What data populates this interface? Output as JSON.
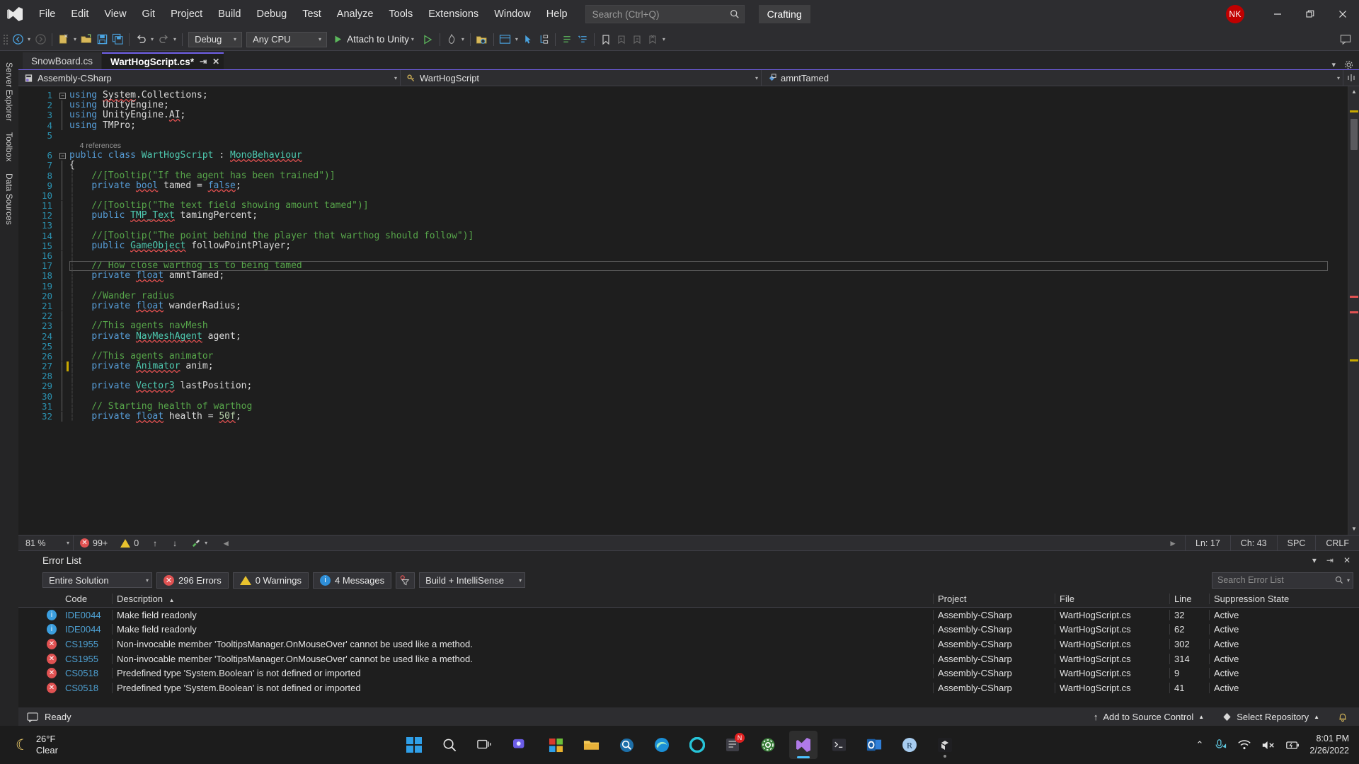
{
  "titlebar": {
    "menu": [
      "File",
      "Edit",
      "View",
      "Git",
      "Project",
      "Build",
      "Debug",
      "Test",
      "Analyze",
      "Tools",
      "Extensions",
      "Window",
      "Help"
    ],
    "search_placeholder": "Search (Ctrl+Q)",
    "solution_name": "Crafting",
    "avatar_initials": "NK",
    "minimize_label": "—",
    "restore_label": "❐",
    "close_label": "✕"
  },
  "toolbar": {
    "config": "Debug",
    "platform": "Any CPU",
    "run_label": "Attach to Unity",
    "undo_icon": "undo-icon",
    "redo_icon": "redo-icon",
    "save_icon": "save-icon",
    "save_all_icon": "save-all-icon",
    "new_project_icon": "new-project-icon",
    "open_file_icon": "open-file-icon",
    "back_icon": "navigate-back-icon",
    "forward_icon": "navigate-forward-icon"
  },
  "left_rail": [
    "Server Explorer",
    "Toolbox",
    "Data Sources"
  ],
  "tabs": [
    {
      "label": "SnowBoard.cs",
      "active": false
    },
    {
      "label": "WartHogScript.cs*",
      "active": true
    }
  ],
  "navbar": {
    "project": "Assembly-CSharp",
    "type": "WartHogScript",
    "member": "amntTamed"
  },
  "editor": {
    "reference_hint": "4 references",
    "reference_hint_line": 6,
    "current_line": 17,
    "changed_lines": [
      27
    ],
    "lines": [
      {
        "n": 1,
        "fold": "minus",
        "tokens": [
          {
            "t": "using ",
            "c": "kw"
          },
          {
            "t": "System",
            "c": "sq-plain"
          },
          {
            "t": ".Collections;",
            "c": "plain"
          }
        ]
      },
      {
        "n": 2,
        "tokens": [
          {
            "t": "using ",
            "c": "kw"
          },
          {
            "t": "UnityEngine;",
            "c": "plain"
          }
        ]
      },
      {
        "n": 3,
        "tokens": [
          {
            "t": "using ",
            "c": "kw"
          },
          {
            "t": "UnityEngine.",
            "c": "plain"
          },
          {
            "t": "AI",
            "c": "sq-plain"
          },
          {
            "t": ";",
            "c": "plain"
          }
        ]
      },
      {
        "n": 4,
        "tokens": [
          {
            "t": "using ",
            "c": "kw"
          },
          {
            "t": "TMPro;",
            "c": "plain"
          }
        ]
      },
      {
        "n": 5,
        "tokens": []
      },
      {
        "n": 6,
        "fold": "minus",
        "tokens": [
          {
            "t": "public ",
            "c": "kw"
          },
          {
            "t": "class ",
            "c": "kw"
          },
          {
            "t": "WartHogScript",
            "c": "type"
          },
          {
            "t": " : ",
            "c": "plain"
          },
          {
            "t": "MonoBehaviour",
            "c": "sq-type"
          }
        ]
      },
      {
        "n": 7,
        "indent": 0,
        "tokens": [
          {
            "t": "{",
            "c": "plain"
          }
        ]
      },
      {
        "n": 8,
        "indent": 1,
        "tokens": [
          {
            "t": "//[Tooltip(\"If the agent has been trained\")]",
            "c": "cmt"
          }
        ]
      },
      {
        "n": 9,
        "indent": 1,
        "tokens": [
          {
            "t": "private ",
            "c": "kw"
          },
          {
            "t": "bool",
            "c": "sq-kw"
          },
          {
            "t": " tamed = ",
            "c": "plain"
          },
          {
            "t": "false",
            "c": "sq-kw"
          },
          {
            "t": ";",
            "c": "plain"
          }
        ]
      },
      {
        "n": 10,
        "indent": 1,
        "tokens": []
      },
      {
        "n": 11,
        "indent": 1,
        "tokens": [
          {
            "t": "//[Tooltip(\"The text field showing amount tamed\")]",
            "c": "cmt"
          }
        ]
      },
      {
        "n": 12,
        "indent": 1,
        "tokens": [
          {
            "t": "public ",
            "c": "kw"
          },
          {
            "t": "TMP_Text",
            "c": "sq-type"
          },
          {
            "t": " tamingPercent;",
            "c": "plain"
          }
        ]
      },
      {
        "n": 13,
        "indent": 1,
        "tokens": []
      },
      {
        "n": 14,
        "indent": 1,
        "tokens": [
          {
            "t": "//[Tooltip(\"The point behind the player that warthog should follow\")]",
            "c": "cmt"
          }
        ]
      },
      {
        "n": 15,
        "indent": 1,
        "tokens": [
          {
            "t": "public ",
            "c": "kw"
          },
          {
            "t": "GameObject",
            "c": "sq-type"
          },
          {
            "t": " followPointPlayer;",
            "c": "plain"
          }
        ]
      },
      {
        "n": 16,
        "indent": 1,
        "tokens": []
      },
      {
        "n": 17,
        "indent": 1,
        "tokens": [
          {
            "t": "// How close warthog is to being tamed",
            "c": "cmt"
          }
        ]
      },
      {
        "n": 18,
        "indent": 1,
        "tokens": [
          {
            "t": "private ",
            "c": "kw"
          },
          {
            "t": "float",
            "c": "sq-kw"
          },
          {
            "t": " amntTamed;",
            "c": "plain"
          }
        ]
      },
      {
        "n": 19,
        "indent": 1,
        "tokens": []
      },
      {
        "n": 20,
        "indent": 1,
        "tokens": [
          {
            "t": "//Wander radius",
            "c": "cmt"
          }
        ]
      },
      {
        "n": 21,
        "indent": 1,
        "tokens": [
          {
            "t": "private ",
            "c": "kw"
          },
          {
            "t": "float",
            "c": "sq-kw"
          },
          {
            "t": " wanderRadius;",
            "c": "plain"
          }
        ]
      },
      {
        "n": 22,
        "indent": 1,
        "tokens": []
      },
      {
        "n": 23,
        "indent": 1,
        "tokens": [
          {
            "t": "//This agents navMesh",
            "c": "cmt"
          }
        ]
      },
      {
        "n": 24,
        "indent": 1,
        "tokens": [
          {
            "t": "private ",
            "c": "kw"
          },
          {
            "t": "NavMeshAgent",
            "c": "sq-type"
          },
          {
            "t": " agent;",
            "c": "plain"
          }
        ]
      },
      {
        "n": 25,
        "indent": 1,
        "tokens": []
      },
      {
        "n": 26,
        "indent": 1,
        "tokens": [
          {
            "t": "//This agents animator",
            "c": "cmt"
          }
        ]
      },
      {
        "n": 27,
        "indent": 1,
        "tokens": [
          {
            "t": "private ",
            "c": "kw"
          },
          {
            "t": "Animator",
            "c": "sq-type"
          },
          {
            "t": " anim;",
            "c": "plain"
          }
        ]
      },
      {
        "n": 28,
        "indent": 1,
        "tokens": []
      },
      {
        "n": 29,
        "indent": 1,
        "tokens": [
          {
            "t": "private ",
            "c": "kw"
          },
          {
            "t": "Vector3",
            "c": "sq-type"
          },
          {
            "t": " lastPosition;",
            "c": "plain"
          }
        ]
      },
      {
        "n": 30,
        "indent": 1,
        "tokens": []
      },
      {
        "n": 31,
        "indent": 1,
        "tokens": [
          {
            "t": "// Starting health of warthog",
            "c": "cmt"
          }
        ]
      },
      {
        "n": 32,
        "indent": 1,
        "tokens": [
          {
            "t": "private ",
            "c": "kw"
          },
          {
            "t": "float",
            "c": "sq-kw"
          },
          {
            "t": " health = ",
            "c": "plain"
          },
          {
            "t": "50f",
            "c": "sq-num"
          },
          {
            "t": ";",
            "c": "plain"
          }
        ]
      }
    ]
  },
  "editor_status": {
    "zoom": "81 %",
    "errors": "99+",
    "warnings": "0",
    "line": "Ln: 17",
    "column": "Ch: 43",
    "spaces": "SPC",
    "line_endings": "CRLF"
  },
  "error_panel": {
    "title": "Error List",
    "scope": "Entire Solution",
    "errors_label": "296 Errors",
    "warnings_label": "0 Warnings",
    "messages_label": "4 Messages",
    "build_filter": "Build + IntelliSense",
    "search_placeholder": "Search Error List",
    "columns": [
      "Code",
      "Description",
      "Project",
      "File",
      "Line",
      "Suppression State"
    ],
    "sorted_column": "Description",
    "sort_direction": "asc",
    "rows": [
      {
        "severity": "info",
        "code": "IDE0044",
        "description": "Make field readonly",
        "project": "Assembly-CSharp",
        "file": "WartHogScript.cs",
        "line": "32",
        "suppression": "Active"
      },
      {
        "severity": "info",
        "code": "IDE0044",
        "description": "Make field readonly",
        "project": "Assembly-CSharp",
        "file": "WartHogScript.cs",
        "line": "62",
        "suppression": "Active"
      },
      {
        "severity": "error",
        "code": "CS1955",
        "description": "Non-invocable member 'TooltipsManager.OnMouseOver' cannot be used like a method.",
        "project": "Assembly-CSharp",
        "file": "WartHogScript.cs",
        "line": "302",
        "suppression": "Active"
      },
      {
        "severity": "error",
        "code": "CS1955",
        "description": "Non-invocable member 'TooltipsManager.OnMouseOver' cannot be used like a method.",
        "project": "Assembly-CSharp",
        "file": "WartHogScript.cs",
        "line": "314",
        "suppression": "Active"
      },
      {
        "severity": "error",
        "code": "CS0518",
        "description": "Predefined type 'System.Boolean' is not defined or imported",
        "project": "Assembly-CSharp",
        "file": "WartHogScript.cs",
        "line": "9",
        "suppression": "Active"
      },
      {
        "severity": "error",
        "code": "CS0518",
        "description": "Predefined type 'System.Boolean' is not defined or imported",
        "project": "Assembly-CSharp",
        "file": "WartHogScript.cs",
        "line": "41",
        "suppression": "Active"
      }
    ]
  },
  "vs_status": {
    "ready": "Ready",
    "add_to_source_control": "Add to Source Control",
    "select_repository": "Select Repository"
  },
  "taskbar": {
    "temperature": "26°F",
    "condition": "Clear",
    "time": "8:01 PM",
    "date": "2/26/2022",
    "notification_badge": "N",
    "apps": [
      {
        "name": "start-button-icon"
      },
      {
        "name": "search-icon"
      },
      {
        "name": "task-view-icon"
      },
      {
        "name": "teams-icon"
      },
      {
        "name": "store-icon"
      },
      {
        "name": "file-explorer-icon"
      },
      {
        "name": "magnifier-icon"
      },
      {
        "name": "edge-icon"
      },
      {
        "name": "circle-app-icon"
      },
      {
        "name": "notes-app-icon"
      },
      {
        "name": "settings-icon"
      },
      {
        "name": "visual-studio-icon"
      },
      {
        "name": "terminal-icon"
      },
      {
        "name": "outlook-icon"
      },
      {
        "name": "resharper-icon"
      },
      {
        "name": "unity-icon"
      }
    ]
  },
  "colors": {
    "accent": "#7160e8",
    "error_red": "#e05252",
    "info_blue": "#3b9ede",
    "warn_yellow": "#e8c22e",
    "avatar_red": "#c00000",
    "keyword_blue": "#569cd6",
    "type_teal": "#4ec9b0",
    "comment_green": "#57a64a",
    "linenum_blue": "#2b91af"
  }
}
